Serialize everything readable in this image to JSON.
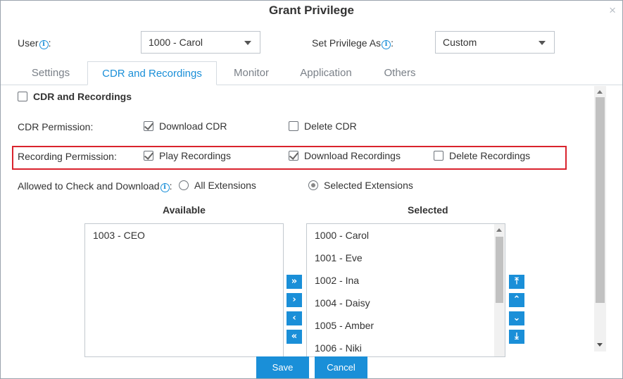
{
  "dialog": {
    "title": "Grant Privilege",
    "close_glyph": "×"
  },
  "user": {
    "label": "User",
    "colon": ":",
    "value": "1000 - Carol"
  },
  "privilege": {
    "label": "Set Privilege As",
    "colon": ":",
    "value": "Custom"
  },
  "tabs": [
    {
      "label": "Settings"
    },
    {
      "label": "CDR and Recordings",
      "active": true
    },
    {
      "label": "Monitor"
    },
    {
      "label": "Application"
    },
    {
      "label": "Others"
    }
  ],
  "section": {
    "label": "CDR and Recordings",
    "checked": false
  },
  "cdr_permission": {
    "label": "CDR Permission:",
    "options": [
      {
        "label": "Download CDR",
        "checked": true
      },
      {
        "label": "Delete CDR",
        "checked": false
      }
    ]
  },
  "recording_permission": {
    "label": "Recording Permission:",
    "options": [
      {
        "label": "Play Recordings",
        "checked": true
      },
      {
        "label": "Download Recordings",
        "checked": true
      },
      {
        "label": "Delete Recordings",
        "checked": false
      }
    ]
  },
  "allowed": {
    "label": "Allowed to Check and Download",
    "colon": ":",
    "options": [
      {
        "label": "All Extensions",
        "selected": false
      },
      {
        "label": "Selected Extensions",
        "selected": true
      }
    ]
  },
  "available": {
    "header": "Available",
    "items": [
      "1003 - CEO"
    ]
  },
  "selected": {
    "header": "Selected",
    "items": [
      "1000 - Carol",
      "1001 - Eve",
      "1002 - Ina",
      "1004 - Daisy",
      "1005 - Amber",
      "1006 - Niki"
    ]
  },
  "transfer_buttons": {
    "add_all": "»",
    "add": "›",
    "remove": "‹",
    "remove_all": "«"
  },
  "order_buttons": {
    "top": "⤒",
    "up": "⌃",
    "down": "⌄",
    "bottom": "⤓"
  },
  "buttons": {
    "save": "Save",
    "cancel": "Cancel"
  },
  "colors": {
    "accent": "#1a8fd8",
    "highlight_border": "#d9232d"
  },
  "icons": [
    "info-icon",
    "close-icon",
    "chevron-down-icon",
    "checkbox-icon",
    "radio-icon",
    "scroll-arrow-icon"
  ]
}
